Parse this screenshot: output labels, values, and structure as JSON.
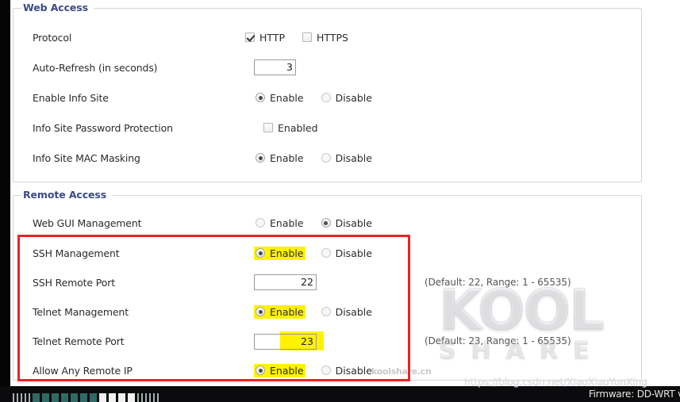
{
  "sections": [
    {
      "id": "web-access",
      "legend": "Web Access",
      "rows": [
        {
          "label": "Protocol",
          "control": "checkbox-group",
          "options": [
            {
              "label": "HTTP",
              "checked": true,
              "highlight": false
            },
            {
              "label": "HTTPS",
              "checked": false,
              "highlight": false
            }
          ]
        },
        {
          "label": "Auto-Refresh (in seconds)",
          "control": "text",
          "value": "3",
          "size": "small"
        },
        {
          "label": "Enable Info Site",
          "control": "radio-group",
          "options": [
            {
              "label": "Enable",
              "selected": true,
              "highlight": false
            },
            {
              "label": "Disable",
              "selected": false,
              "highlight": false
            }
          ]
        },
        {
          "label": "Info Site Password Protection",
          "control": "checkbox-group",
          "options": [
            {
              "label": "Enabled",
              "checked": false,
              "highlight": false
            }
          ]
        },
        {
          "label": "Info Site MAC Masking",
          "control": "radio-group",
          "options": [
            {
              "label": "Enable",
              "selected": true,
              "highlight": false
            },
            {
              "label": "Disable",
              "selected": false,
              "highlight": false
            }
          ]
        }
      ]
    },
    {
      "id": "remote-access",
      "legend": "Remote Access",
      "rows": [
        {
          "label": "Web GUI Management",
          "control": "radio-group",
          "options": [
            {
              "label": "Enable",
              "selected": false,
              "highlight": false
            },
            {
              "label": "Disable",
              "selected": true,
              "highlight": false
            }
          ]
        },
        {
          "label": "SSH Management",
          "control": "radio-group",
          "options": [
            {
              "label": "Enable",
              "selected": true,
              "highlight": true
            },
            {
              "label": "Disable",
              "selected": false,
              "highlight": false
            }
          ]
        },
        {
          "label": "SSH Remote Port",
          "control": "text",
          "value": "22",
          "size": "port",
          "hint": "(Default: 22, Range: 1 - 65535)"
        },
        {
          "label": "Telnet Management",
          "control": "radio-group",
          "options": [
            {
              "label": "Enable",
              "selected": true,
              "highlight": true
            },
            {
              "label": "Disable",
              "selected": false,
              "highlight": false
            }
          ]
        },
        {
          "label": "Telnet Remote Port",
          "control": "text",
          "value": "23",
          "size": "port",
          "value_highlight": true,
          "hint": "(Default: 23, Range: 1 - 65535)"
        },
        {
          "label": "Allow Any Remote IP",
          "control": "radio-group",
          "options": [
            {
              "label": "Enable",
              "selected": true,
              "highlight": true
            },
            {
              "label": "Disable",
              "selected": false,
              "highlight": false
            }
          ]
        }
      ]
    }
  ],
  "annotation": {
    "type": "red-rectangle",
    "color": "#ee2222"
  },
  "watermarks": {
    "brand_primary": "KOOL",
    "brand_secondary": "SHARE",
    "site": "koolshare.cn",
    "url": "https://blog.csdn.net/XiaoXiaoYunXing"
  },
  "statusbar": {
    "firmware": "Firmware: DD-WRT v"
  },
  "colors": {
    "legend": "#3b4a86",
    "highlight": "#fff200",
    "annotation": "#ee2222",
    "statusbar_bg": "#0b0b0d"
  }
}
